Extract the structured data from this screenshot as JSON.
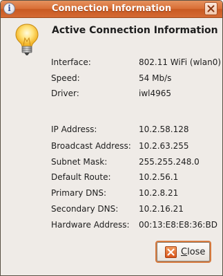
{
  "window": {
    "title": "Connection Information",
    "title_icon": "info-icon"
  },
  "main": {
    "icon": "lightbulb-icon",
    "heading": "Active Connection Information",
    "device_rows": [
      {
        "label": "Interface:",
        "value": "802.11 WiFi (wlan0)"
      },
      {
        "label": "Speed:",
        "value": "54 Mb/s"
      },
      {
        "label": "Driver:",
        "value": "iwl4965"
      }
    ],
    "network_rows": [
      {
        "label": "IP Address:",
        "value": "10.2.58.128"
      },
      {
        "label": "Broadcast Address:",
        "value": "10.2.63.255"
      },
      {
        "label": "Subnet Mask:",
        "value": "255.255.248.0"
      },
      {
        "label": "Default Route:",
        "value": "10.2.56.1"
      },
      {
        "label": "Primary DNS:",
        "value": "10.2.8.21"
      },
      {
        "label": "Secondary DNS:",
        "value": "10.2.16.21"
      },
      {
        "label": "Hardware Address:",
        "value": "00:13:E8:E8:36:BD"
      }
    ]
  },
  "buttons": {
    "close_mnemonic": "C",
    "close_rest": "lose",
    "close_icon": "close-icon"
  },
  "colors": {
    "titlebar": "#d96f36",
    "dialog_background": "#efebe7",
    "button_focus_border": "#d77a3e"
  }
}
